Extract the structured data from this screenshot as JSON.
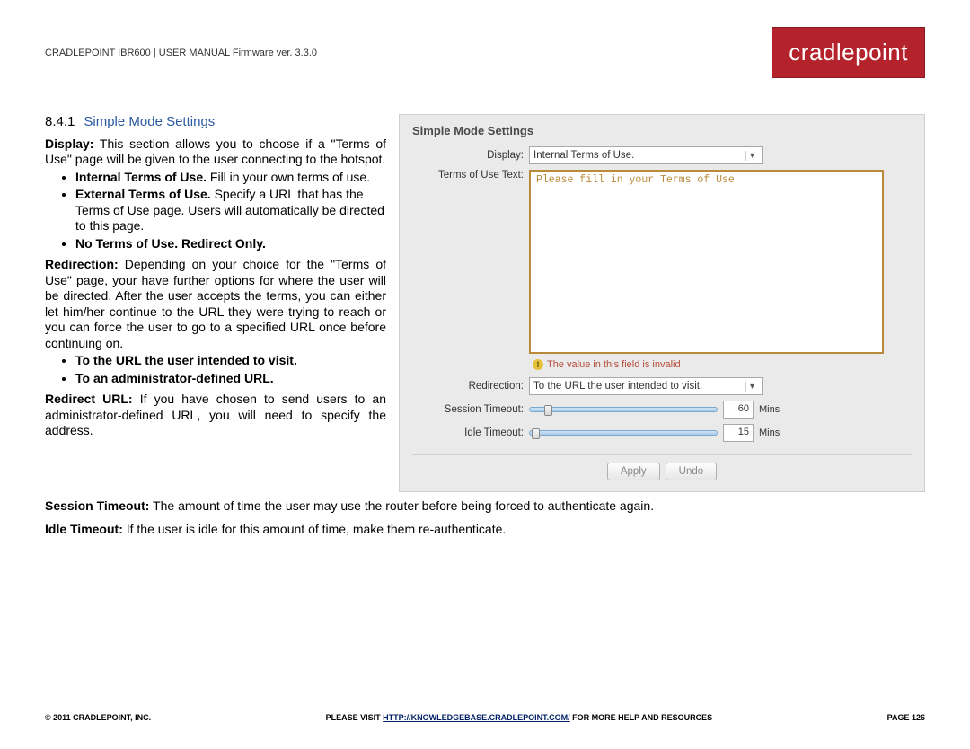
{
  "header": {
    "left": "CRADLEPOINT IBR600 | USER MANUAL Firmware ver. 3.3.0",
    "logo": "cradlepoint"
  },
  "section": {
    "number": "8.4.1",
    "title": "Simple Mode Settings"
  },
  "body": {
    "display_label": "Display:",
    "display_text": " This section allows you to choose if a \"Terms of Use\" page will be given to the user connecting to the hotspot.",
    "bullets1": {
      "b1_bold": "Internal Terms of Use.",
      "b1_rest": " Fill in your own terms of use.",
      "b2_bold": "External Terms of Use.",
      "b2_rest": " Specify a URL that has the Terms of Use page. Users will automatically be directed to this page.",
      "b3_bold": "No Terms of Use. Redirect Only."
    },
    "redirection_label": "Redirection:",
    "redirection_text": " Depending on your choice for the \"Terms of Use\" page, your have further options for where the user will be directed. After the user accepts the terms, you can either let him/her continue to the URL they were trying to reach or you can force the user to go to a specified URL once before continuing on.",
    "bullets2": {
      "b1": "To the URL the user intended to visit.",
      "b2": "To an administrator-defined URL."
    },
    "redirect_url_label": "Redirect URL:",
    "redirect_url_text": " If you have chosen to send users to an administrator-defined URL, you will need to specify the address.",
    "session_label": "Session Timeout:",
    "session_text": " The amount of time the user may use the router before being forced to authenticate again.",
    "idle_label": "Idle Timeout:",
    "idle_text": " If the user is idle for this amount of time, make them re-authenticate."
  },
  "panel": {
    "title": "Simple Mode Settings",
    "display_lbl": "Display:",
    "display_val": "Internal Terms of Use.",
    "tou_lbl": "Terms of Use Text:",
    "tou_placeholder": "Please fill in your Terms of Use",
    "error": "The value in this field is invalid",
    "redirection_lbl": "Redirection:",
    "redirection_val": "To the URL the user intended to visit.",
    "session_lbl": "Session Timeout:",
    "session_val": "60",
    "idle_lbl": "Idle Timeout:",
    "idle_val": "15",
    "mins": "Mins",
    "apply": "Apply",
    "undo": "Undo"
  },
  "footer": {
    "left": "© 2011 CRADLEPOINT, INC.",
    "center_pre": "PLEASE VISIT ",
    "center_link": "HTTP://KNOWLEDGEBASE.CRADLEPOINT.COM/",
    "center_post": " FOR MORE HELP AND RESOURCES",
    "right": "PAGE 126"
  }
}
